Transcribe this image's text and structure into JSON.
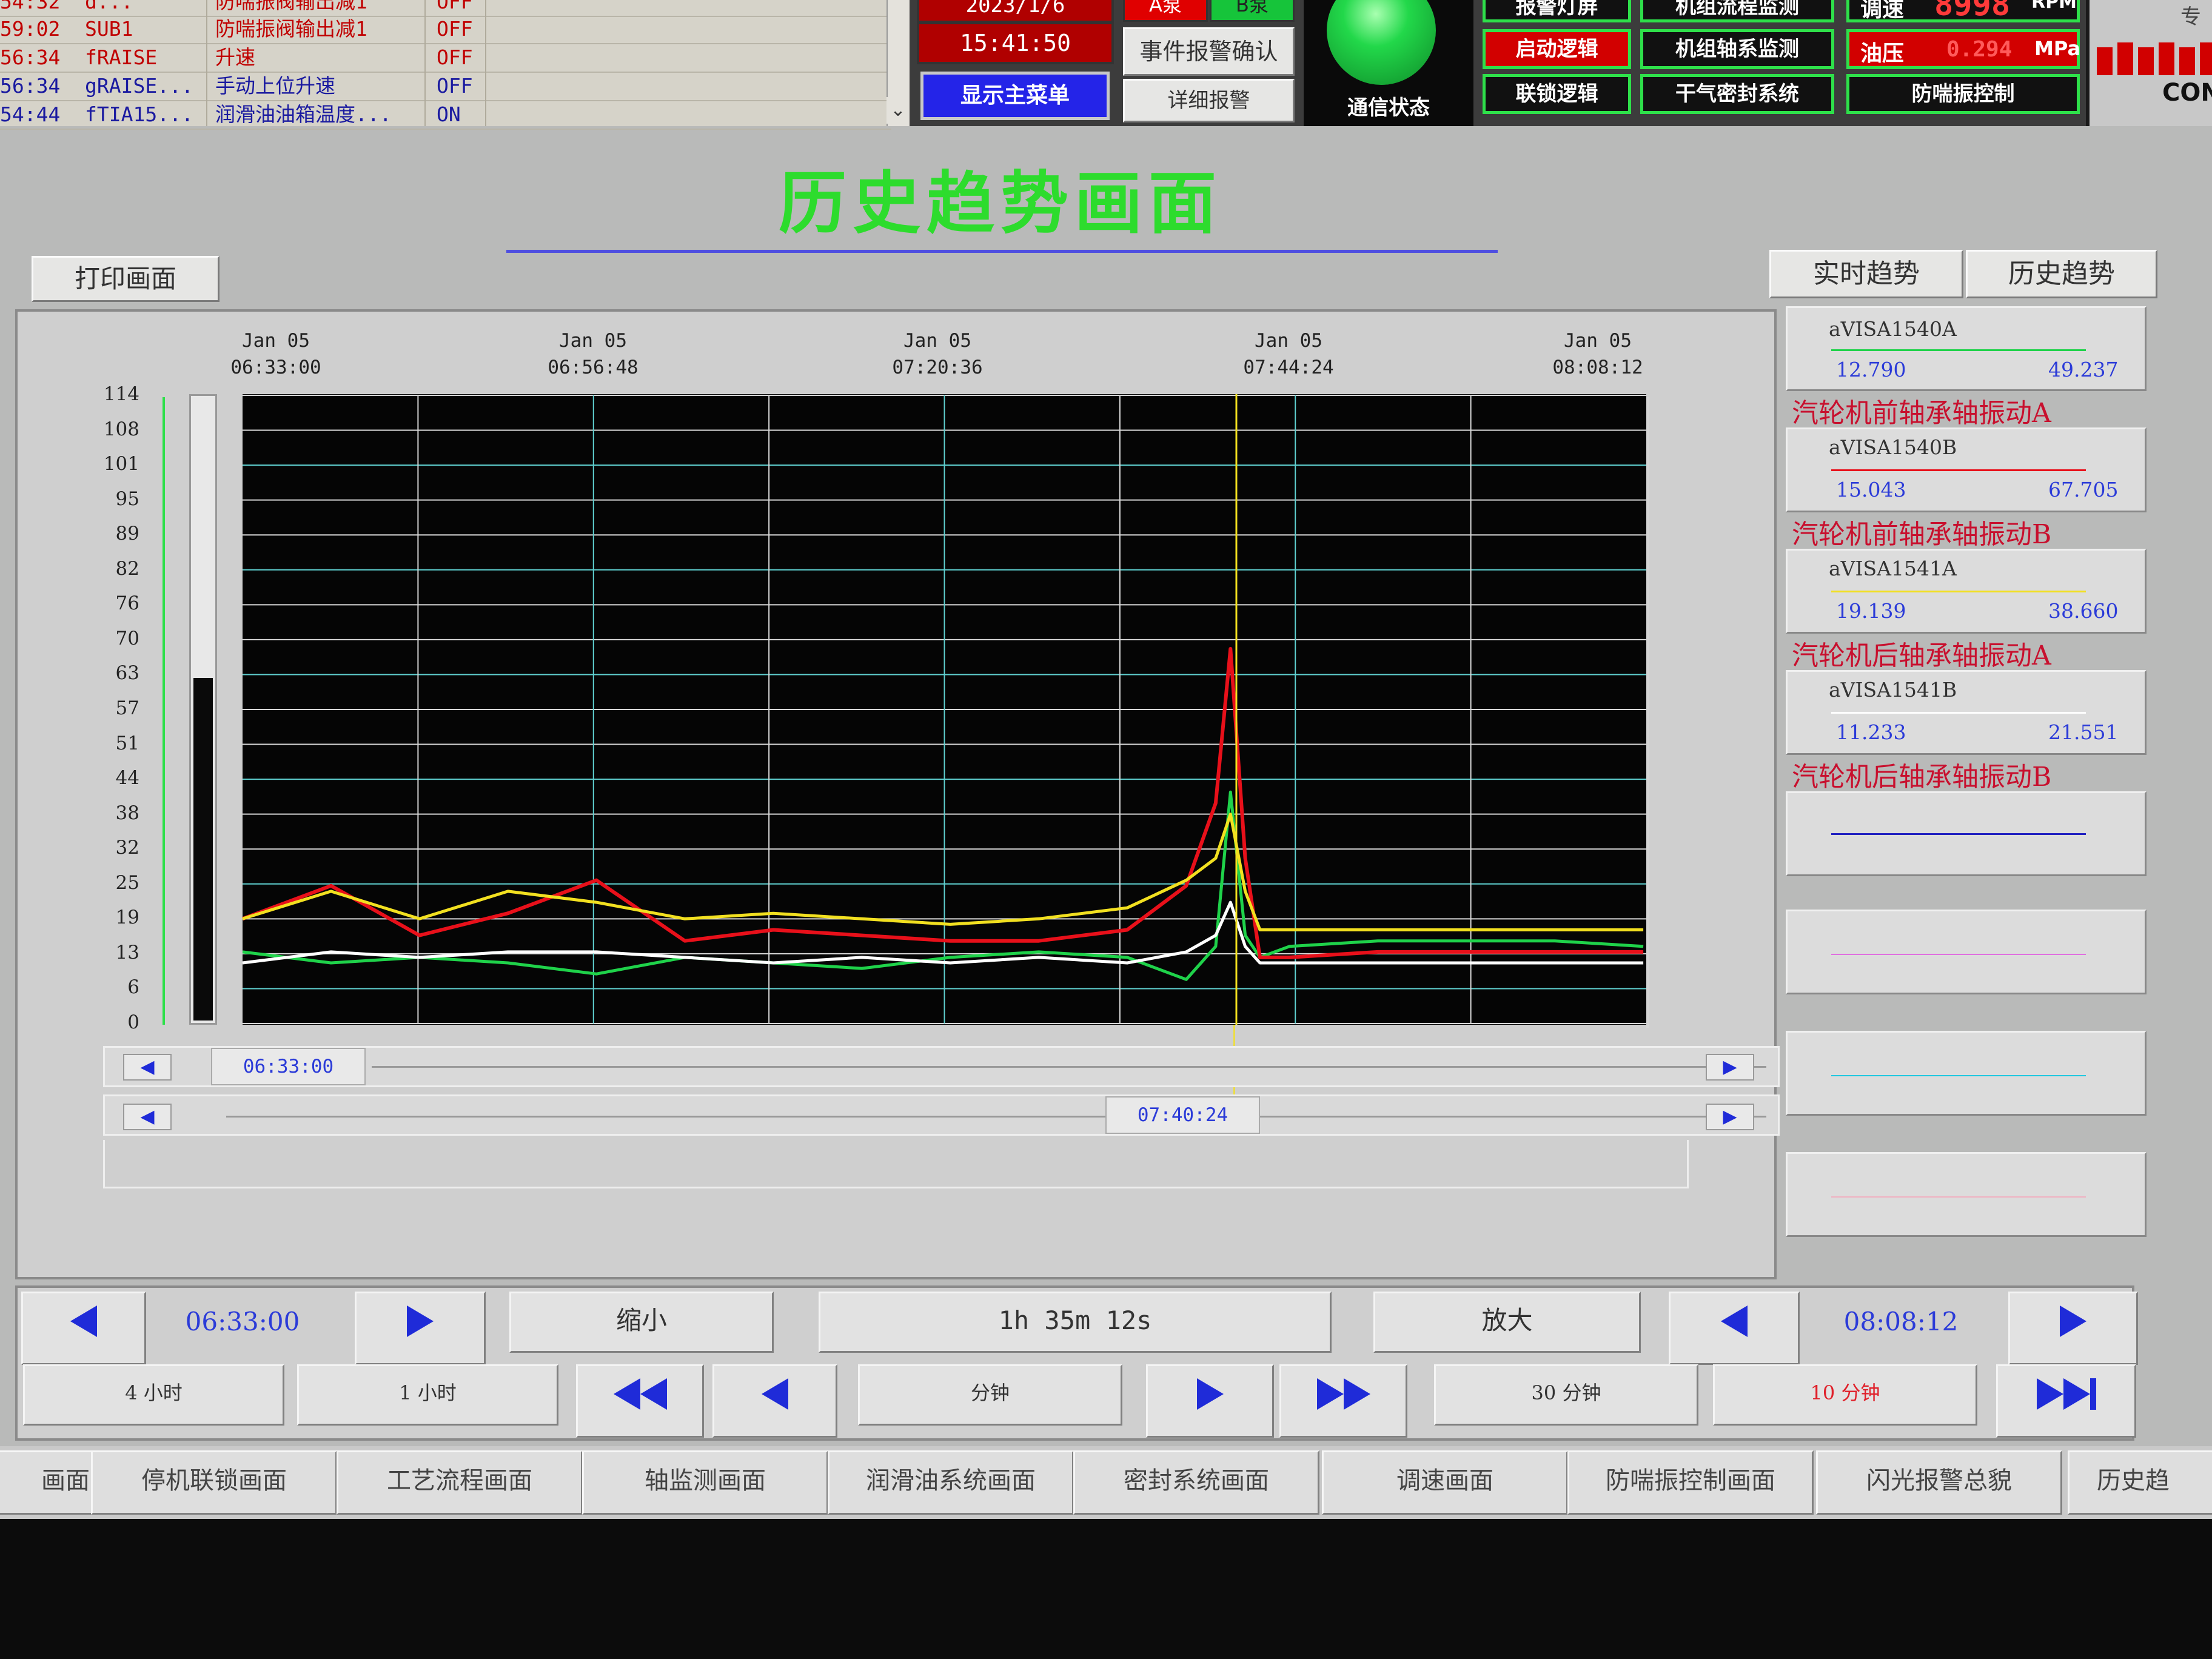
{
  "alarms": [
    {
      "time": "54:32",
      "tag": "d...",
      "desc": "防喘振阀输出减1",
      "state": "OFF",
      "color": "#c00000"
    },
    {
      "time": "59:02",
      "tag": "SUB1",
      "desc": "防喘振阀输出减1",
      "state": "OFF",
      "color": "#c00000"
    },
    {
      "time": "56:34",
      "tag": "fRAISE",
      "desc": "升速",
      "state": "OFF",
      "color": "#c00000"
    },
    {
      "time": "56:34",
      "tag": "gRAISE...",
      "desc": "手动上位升速",
      "state": "OFF",
      "color": "#1a1aa0"
    },
    {
      "time": "54:44",
      "tag": "fTIA15...",
      "desc": "润滑油油箱温度...",
      "state": "ON",
      "color": "#1a1aa0"
    }
  ],
  "top": {
    "date": "2023/1/6",
    "time": "15:41:50",
    "main_menu": "显示主菜单",
    "pump_a": "A泵",
    "pump_b": "B泵",
    "event_ack": "事件报警确认",
    "detail_alarm": "详细报警",
    "comm_status": "通信状态",
    "buttons": {
      "alarm_light": "报警灯屏",
      "flow_monitor": "机组流程监测",
      "start_logic": "启动逻辑",
      "axis_monitor": "机组轴系监测",
      "interlock": "联锁逻辑",
      "dry_gas": "干气密封系统",
      "antisurge": "防喘振控制"
    },
    "speed_label": "调速",
    "speed_value": "8998",
    "speed_unit": "RPM",
    "oil_label": "油压",
    "oil_value": "0.294",
    "oil_unit": "MPa",
    "corner_label": "专",
    "logo_text": "CON"
  },
  "title": "历史趋势画面",
  "print_button": "打印画面",
  "tab_realtime": "实时趋势",
  "tab_history": "历史趋势",
  "time_axis": [
    {
      "date": "Jan 05",
      "time": "06:33:00"
    },
    {
      "date": "Jan 05",
      "time": "06:56:48"
    },
    {
      "date": "Jan 05",
      "time": "07:20:36"
    },
    {
      "date": "Jan 05",
      "time": "07:44:24"
    },
    {
      "date": "Jan 05",
      "time": "08:08:12"
    }
  ],
  "y_ticks": [
    "114",
    "108",
    "101",
    "95",
    "89",
    "82",
    "76",
    "70",
    "63",
    "57",
    "51",
    "44",
    "38",
    "32",
    "25",
    "19",
    "13",
    "6",
    "0"
  ],
  "scroll_start": "06:33:00",
  "cursor_time": "07:40:24",
  "legend": [
    {
      "tag": "aVISA1540A",
      "min": "12.790",
      "max": "49.237",
      "color": "#1fd24a",
      "desc": "汽轮机前轴承轴振动A"
    },
    {
      "tag": "aVISA1540B",
      "min": "15.043",
      "max": "67.705",
      "color": "#e8101a",
      "desc": "汽轮机前轴承轴振动B"
    },
    {
      "tag": "aVISA1541A",
      "min": "19.139",
      "max": "38.660",
      "color": "#f2e020",
      "desc": "汽轮机后轴承轴振动A"
    },
    {
      "tag": "aVISA1541B",
      "min": "11.233",
      "max": "21.551",
      "color": "#ffffff",
      "desc": "汽轮机后轴承轴振动B"
    },
    {
      "tag": "",
      "min": "",
      "max": "",
      "color": "#2020c0",
      "desc": ""
    },
    {
      "tag": "",
      "min": "",
      "max": "",
      "color": "#e070e0",
      "desc": ""
    },
    {
      "tag": "",
      "min": "",
      "max": "",
      "color": "#20c8e0",
      "desc": ""
    },
    {
      "tag": "",
      "min": "",
      "max": "",
      "color": "#f0b0c0",
      "desc": ""
    }
  ],
  "controls": {
    "start_time": "06:33:00",
    "zoom_out": "缩小",
    "span": "1h 35m 12s",
    "zoom_in": "放大",
    "end_time": "08:08:12",
    "h4": "4 小时",
    "h1": "1 小时",
    "minute": "分钟",
    "m30": "30 分钟",
    "m10": "10 分钟"
  },
  "nav": [
    "画面",
    "停机联锁画面",
    "工艺流程画面",
    "轴监测画面",
    "润滑油系统画面",
    "密封系统画面",
    "调速画面",
    "防喘振控制画面",
    "闪光报警总貌",
    "历史趋"
  ],
  "chart_data": {
    "type": "line",
    "x_start": "Jan 05 06:33:00",
    "x_end": "Jan 05 08:08:12",
    "ylim": [
      0,
      114
    ],
    "cursor": "07:40:24",
    "x": [
      "06:33",
      "06:39",
      "06:45",
      "06:51",
      "06:57",
      "07:03",
      "07:09",
      "07:15",
      "07:21",
      "07:27",
      "07:33",
      "07:37",
      "07:39",
      "07:40",
      "07:41",
      "07:42",
      "07:44",
      "07:50",
      "07:56",
      "08:02",
      "08:08"
    ],
    "series": [
      {
        "name": "aVISA1540A",
        "color": "#1fd24a",
        "values": [
          13,
          11,
          12,
          11,
          9,
          12,
          11,
          10,
          12,
          13,
          12,
          8,
          14,
          42,
          16,
          12,
          14,
          15,
          15,
          15,
          14
        ]
      },
      {
        "name": "aVISA1540B",
        "color": "#e8101a",
        "values": [
          19,
          25,
          16,
          20,
          26,
          15,
          17,
          16,
          15,
          15,
          17,
          25,
          40,
          68,
          30,
          12,
          12,
          13,
          13,
          13,
          13
        ]
      },
      {
        "name": "aVISA1541A",
        "color": "#f2e020",
        "values": [
          19,
          24,
          19,
          24,
          22,
          19,
          20,
          19,
          18,
          19,
          21,
          26,
          30,
          38,
          24,
          17,
          17,
          17,
          17,
          17,
          17
        ]
      },
      {
        "name": "aVISA1541B",
        "color": "#ffffff",
        "values": [
          11,
          13,
          12,
          13,
          13,
          12,
          11,
          12,
          11,
          12,
          11,
          13,
          16,
          22,
          14,
          11,
          11,
          11,
          11,
          11,
          11
        ]
      }
    ]
  }
}
